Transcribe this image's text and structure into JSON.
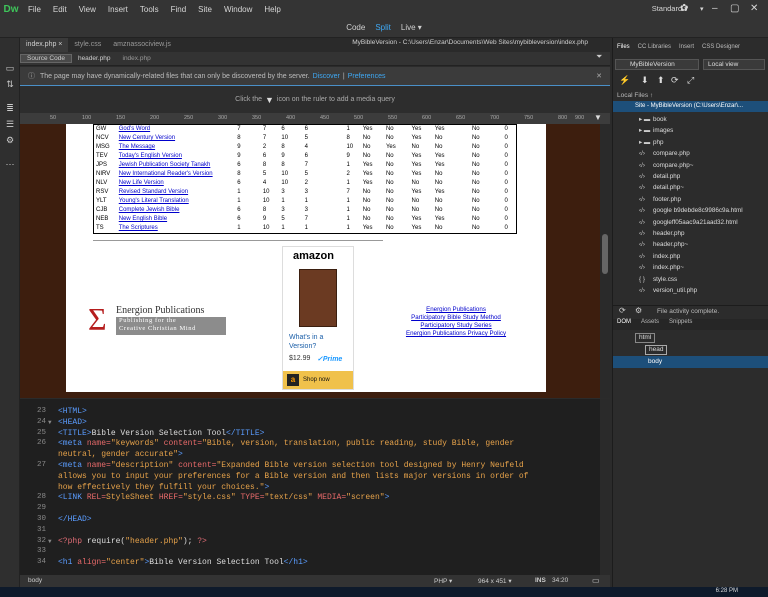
{
  "app": {
    "logo": "Dw",
    "workspace": "Standard ▾"
  },
  "menu": [
    "File",
    "Edit",
    "View",
    "Insert",
    "Tools",
    "Find",
    "Site",
    "Window",
    "Help"
  ],
  "views": {
    "code": "Code",
    "split": "Split",
    "live": "Live ▾"
  },
  "document": {
    "tabs": [
      {
        "label": "index.php ×",
        "active": true
      },
      {
        "label": "style.css",
        "active": false
      },
      {
        "label": "amznassociview.js",
        "active": false
      }
    ],
    "path": "MyBibleVersion - C:\\Users\\Enzar\\Documents\\Web Sites\\mybibleversion\\index.php"
  },
  "related_tabs": [
    "Source Code",
    "header.php",
    "index.php"
  ],
  "info": {
    "message": "The page may have dynamically-related files that can only be discovered by the server.",
    "discover": "Discover",
    "sep": "|",
    "preferences": "Preferences"
  },
  "media_query_hint": {
    "before": "Click the",
    "after": "icon on the ruler to add a media query"
  },
  "ruler": [
    "50",
    "100",
    "150",
    "200",
    "250",
    "300",
    "350",
    "400",
    "450",
    "500",
    "550",
    "600",
    "650",
    "700",
    "750",
    "800",
    "900"
  ],
  "versions_table": [
    [
      "GW",
      "God's Word",
      "7",
      "7",
      "6",
      "6",
      "1",
      "Yes",
      "No",
      "Yes",
      "Yes",
      "No",
      "0"
    ],
    [
      "NCV",
      "New Century Version",
      "8",
      "7",
      "10",
      "5",
      "8",
      "No",
      "No",
      "Yes",
      "No",
      "No",
      "0"
    ],
    [
      "MSG",
      "The Message",
      "9",
      "2",
      "8",
      "4",
      "10",
      "No",
      "Yes",
      "No",
      "No",
      "No",
      "0"
    ],
    [
      "TEV",
      "Today's English Version",
      "9",
      "6",
      "9",
      "6",
      "9",
      "No",
      "No",
      "Yes",
      "Yes",
      "No",
      "0"
    ],
    [
      "JPS",
      "Jewish Publication Society Tanakh",
      "6",
      "8",
      "8",
      "7",
      "1",
      "Yes",
      "No",
      "Yes",
      "Yes",
      "No",
      "0"
    ],
    [
      "NIRV",
      "New International Reader's Version",
      "8",
      "5",
      "10",
      "5",
      "2",
      "Yes",
      "No",
      "Yes",
      "No",
      "No",
      "0"
    ],
    [
      "NLV",
      "New Life Version",
      "6",
      "4",
      "10",
      "2",
      "1",
      "Yes",
      "No",
      "No",
      "No",
      "No",
      "0"
    ],
    [
      "RSV",
      "Revised Standard Version",
      "1",
      "10",
      "3",
      "3",
      "7",
      "No",
      "No",
      "Yes",
      "Yes",
      "No",
      "0"
    ],
    [
      "YLT",
      "Young's Literal Translation",
      "1",
      "10",
      "1",
      "1",
      "1",
      "No",
      "No",
      "No",
      "No",
      "No",
      "0"
    ],
    [
      "CJB",
      "Complete Jewish Bible",
      "6",
      "8",
      "3",
      "3",
      "1",
      "No",
      "No",
      "No",
      "No",
      "No",
      "0"
    ],
    [
      "NEB",
      "New English Bible",
      "6",
      "9",
      "5",
      "7",
      "1",
      "No",
      "No",
      "Yes",
      "Yes",
      "No",
      "0"
    ],
    [
      "TS",
      "The Scriptures",
      "1",
      "10",
      "1",
      "1",
      "1",
      "Yes",
      "No",
      "Yes",
      "No",
      "No",
      "0"
    ]
  ],
  "amazon": {
    "logo": "amazon",
    "question": "What's in a Version?",
    "price": "$12.99",
    "prime": "✓Prime",
    "shop": "Shop now",
    "a": "a"
  },
  "energion": {
    "sigma": "Σ",
    "title": "Energion Publications",
    "sub1": "Publishing for the",
    "sub2": "Creative Christian Mind",
    "links": [
      "Energion Publications",
      "Participatory Bible Study Method",
      "Participatory Study Series",
      "Energion Publications Privacy Policy"
    ]
  },
  "code_lines": [
    {
      "n": "23",
      "fold": "",
      "html": "<span class='tg'>&lt;HTML&gt;</span>"
    },
    {
      "n": "24",
      "fold": "▼",
      "html": "<span class='tg'>&lt;HEAD&gt;</span>"
    },
    {
      "n": "25",
      "fold": "",
      "html": "<span class='tg'>&lt;TITLE&gt;</span>Bible Version Selection Tool<span class='tg'>&lt;/TITLE&gt;</span>"
    },
    {
      "n": "26",
      "fold": "",
      "html": "<span class='tg'>&lt;meta</span> <span class='at'>name=</span><span class='st'>\"keywords\"</span> <span class='at'>content=</span><span class='st'>\"Bible, version, translation, public reading, study Bible, gender</span>"
    },
    {
      "n": "",
      "fold": "",
      "html": "<span class='st'>neutral, gender accurate\"</span><span class='tg'>&gt;</span>"
    },
    {
      "n": "27",
      "fold": "",
      "html": "<span class='tg'>&lt;meta</span> <span class='at'>name=</span><span class='st'>\"description\"</span> <span class='at'>content=</span><span class='st'>\"Expanded Bible version selection tool designed by Henry Neufeld</span>"
    },
    {
      "n": "",
      "fold": "",
      "html": "<span class='st'>allows you to input your preferences for a Bible version and then lists major versions in order of</span>"
    },
    {
      "n": "",
      "fold": "",
      "html": "<span class='st'>how effectively they fulfill your choices.\"</span><span class='tg'>&gt;</span>"
    },
    {
      "n": "28",
      "fold": "",
      "html": "<span class='tg'>&lt;LINK</span> <span class='at'>REL=</span><span class='st'>StyleSheet</span> <span class='at'>HREF=</span><span class='st'>\"style.css\"</span> <span class='at'>TYPE=</span><span class='st'>\"text/css\"</span> <span class='at'>MEDIA=</span><span class='st'>\"screen\"</span><span class='tg'>&gt;</span>"
    },
    {
      "n": "29",
      "fold": "",
      "html": ""
    },
    {
      "n": "30",
      "fold": "",
      "html": "<span class='tg'>&lt;/HEAD&gt;</span>"
    },
    {
      "n": "31",
      "fold": "",
      "html": ""
    },
    {
      "n": "32",
      "fold": "▼",
      "html": "<span class='ph'>&lt;?php</span> require(<span class='st'>\"header.php\"</span>); <span class='ph'>?&gt;</span>"
    },
    {
      "n": "33",
      "fold": "",
      "html": ""
    },
    {
      "n": "34",
      "fold": "",
      "html": "<span class='tg'>&lt;h1</span> <span class='at'>align=</span><span class='st'>\"center\"</span><span class='tg'>&gt;</span>Bible Version Selection Tool<span class='tg'>&lt;/h1&gt;</span>"
    }
  ],
  "status": {
    "tag": "body",
    "lang": "PHP ▾",
    "size": "964 x 451 ▾",
    "mode": "INS",
    "pos": "34:20"
  },
  "taskbar": {
    "clock": "6:28 PM"
  },
  "right_panel": {
    "tabs": [
      "Files",
      "CC Libraries",
      "Insert",
      "CSS Designer"
    ],
    "site_select": "MyBibleVersion",
    "view_select": "Local view",
    "local_files": "Local Files ↑",
    "site_row": "Site - MyBibleVersion (C:\\Users\\Enzar\\...",
    "files": [
      {
        "icon": "▸ ▬",
        "name": "book"
      },
      {
        "icon": "▸ ▬",
        "name": "images"
      },
      {
        "icon": "▸ ▬",
        "name": "php"
      },
      {
        "icon": "‹/›",
        "name": "compare.php"
      },
      {
        "icon": "‹/›",
        "name": "compare.php~"
      },
      {
        "icon": "‹/›",
        "name": "detail.php"
      },
      {
        "icon": "‹/›",
        "name": "detail.php~"
      },
      {
        "icon": "‹/›",
        "name": "footer.php"
      },
      {
        "icon": "‹/›",
        "name": "google b9debde8c9986c9a.html"
      },
      {
        "icon": "‹/›",
        "name": "googleff05aac9a21aad32.html"
      },
      {
        "icon": "‹/›",
        "name": "header.php"
      },
      {
        "icon": "‹/›",
        "name": "header.php~"
      },
      {
        "icon": "‹/›",
        "name": "index.php"
      },
      {
        "icon": "‹/›",
        "name": "index.php~"
      },
      {
        "icon": "{ }",
        "name": "style.css"
      },
      {
        "icon": "‹/›",
        "name": "version_util.php"
      }
    ],
    "activity": "File activity complete.",
    "dom_tabs": [
      "DOM",
      "Assets",
      "Snippets"
    ],
    "dom": {
      "html": "html",
      "head": "head",
      "body": "body"
    }
  }
}
